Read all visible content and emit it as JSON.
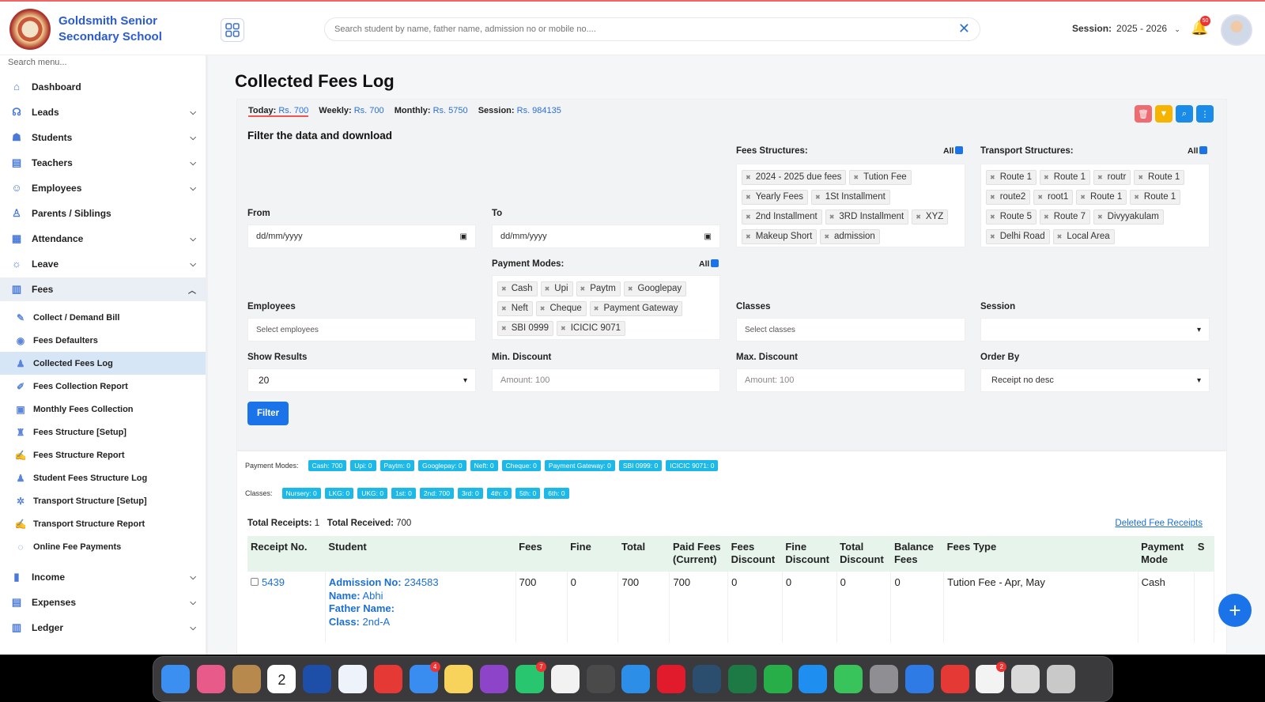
{
  "app": {
    "school_name_line1": "Goldsmith Senior",
    "school_name_line2": "Secondary School",
    "search_placeholder": "Search student by name, father name, admission no or mobile no....",
    "session_label": "Session:",
    "session_value": "2025 - 2026",
    "notification_count": "50"
  },
  "sidebar": {
    "search_placeholder": "Search menu...",
    "items": [
      {
        "label": "Dashboard",
        "icon": "home-icon"
      },
      {
        "label": "Leads",
        "icon": "leads-icon"
      },
      {
        "label": "Students",
        "icon": "students-icon"
      },
      {
        "label": "Teachers",
        "icon": "teachers-icon"
      },
      {
        "label": "Employees",
        "icon": "employees-icon"
      },
      {
        "label": "Parents / Siblings",
        "icon": "parents-icon"
      },
      {
        "label": "Attendance",
        "icon": "attendance-icon"
      },
      {
        "label": "Leave",
        "icon": "leave-icon"
      },
      {
        "label": "Fees",
        "icon": "fees-icon"
      }
    ],
    "fees_sub": [
      "Collect / Demand Bill",
      "Fees Defaulters",
      "Collected Fees Log",
      "Fees Collection Report",
      "Monthly Fees Collection",
      "Fees Structure [Setup]",
      "Fees Structure Report",
      "Student Fees Structure Log",
      "Transport Structure [Setup]",
      "Transport Structure Report",
      "Online Fee Payments"
    ],
    "bottom_items": [
      "Income",
      "Expenses",
      "Ledger"
    ]
  },
  "page": {
    "title": "Collected Fees Log",
    "today_label": "Today:",
    "today_value": "Rs. 700",
    "weekly_label": "Weekly:",
    "weekly_value": "Rs. 700",
    "monthly_label": "Monthly:",
    "monthly_value": "Rs. 5750",
    "session_label": "Session:",
    "session_value": "Rs. 984135",
    "filter_heading": "Filter the data and download"
  },
  "filters": {
    "from_label": "From",
    "from_value": "dd/mm/yyyy",
    "to_label": "To",
    "to_value": "dd/mm/yyyy",
    "fees_structures_label": "Fees Structures:",
    "transport_structures_label": "Transport Structures:",
    "payment_modes_label": "Payment Modes:",
    "all_label": "All",
    "fees_structures": [
      "2024 - 2025 due fees",
      "Tution Fee",
      "Yearly Fees",
      "1St Installment",
      "2nd Installment",
      "3RD Installment",
      "XYZ",
      "Makeup Short",
      "admission"
    ],
    "transport_structures": [
      "Route 1",
      "Route 1",
      "routr",
      "Route 1",
      "route2",
      "root1",
      "Route 1",
      "Route 1",
      "Route 5",
      "Route 7",
      "Divyyakulam",
      "Delhi Road",
      "Local Area"
    ],
    "payment_modes": [
      "Cash",
      "Upi",
      "Paytm",
      "Googlepay",
      "Neft",
      "Cheque",
      "Payment Gateway",
      "SBI 0999",
      "ICICIC 9071"
    ],
    "employees_label": "Employees",
    "employees_placeholder": "Select employees",
    "classes_label": "Classes",
    "classes_placeholder": "Select classes",
    "session_label": "Session",
    "session_value": "",
    "show_results_label": "Show Results",
    "show_results_value": "20",
    "min_discount_label": "Min. Discount",
    "min_discount_placeholder": "Amount: 100",
    "max_discount_label": "Max. Discount",
    "max_discount_placeholder": "Amount: 100",
    "order_by_label": "Order By",
    "order_by_value": "Receipt no desc",
    "filter_button": "Filter"
  },
  "summary": {
    "payment_modes_label": "Payment Modes:",
    "payment_modes": [
      "Cash: 700",
      "Upi: 0",
      "Paytm: 0",
      "Googlepay: 0",
      "Neft: 0",
      "Cheque: 0",
      "Payment Gateway: 0",
      "SBI 0999: 0",
      "ICICIC 9071: 0"
    ],
    "classes_label": "Classes:",
    "classes": [
      "Nursery: 0",
      "LKG: 0",
      "UKG: 0",
      "1st: 0",
      "2nd: 700",
      "3rd: 0",
      "4th: 0",
      "5th: 0",
      "6th: 0"
    ],
    "total_receipts_label": "Total Receipts:",
    "total_receipts_value": "1",
    "total_received_label": "Total Received:",
    "total_received_value": "700",
    "deleted_link": "Deleted Fee Receipts"
  },
  "table": {
    "headers": [
      "Receipt No.",
      "Student",
      "Fees",
      "Fine",
      "Total",
      "Paid Fees (Current)",
      "Fees Discount",
      "Fine Discount",
      "Total Discount",
      "Balance Fees",
      "Fees Type",
      "Payment Mode",
      "S"
    ],
    "row": {
      "receipt_no": "5439",
      "admission_label": "Admission No:",
      "admission_value": "234583",
      "name_label": "Name:",
      "name_value": "Abhi",
      "father_label": "Father Name:",
      "father_value": "",
      "class_label": "Class:",
      "class_value": "2nd-A",
      "fees": "700",
      "fine": "0",
      "total": "700",
      "paid": "700",
      "fees_discount": "0",
      "fine_discount": "0",
      "total_discount": "0",
      "balance": "0",
      "fees_type": "Tution Fee - Apr, May",
      "payment_mode": "Cash"
    }
  },
  "dock": {
    "icons": [
      {
        "name": "finder-icon",
        "color": "#3b8ff0"
      },
      {
        "name": "launchpad-icon",
        "color": "#e85a8a"
      },
      {
        "name": "contacts-icon",
        "color": "#b8894d"
      },
      {
        "name": "calendar-icon",
        "color": "#ffffff",
        "text": "2"
      },
      {
        "name": "vedmarg-icon",
        "color": "#1e4fa8"
      },
      {
        "name": "vedmarg-admin-icon",
        "color": "#eef2fb"
      },
      {
        "name": "anydesk-icon",
        "color": "#e53935"
      },
      {
        "name": "mail-icon",
        "color": "#3a8df0",
        "badge": "4"
      },
      {
        "name": "notes-icon",
        "color": "#f7d35b"
      },
      {
        "name": "firefox-icon",
        "color": "#8e44c8"
      },
      {
        "name": "whatsapp-icon",
        "color": "#28c76f",
        "badge": "7"
      },
      {
        "name": "chrome-icon",
        "color": "#f2f2f2"
      },
      {
        "name": "sublime-icon",
        "color": "#4a4a4a"
      },
      {
        "name": "safari-icon",
        "color": "#2d8ee8"
      },
      {
        "name": "opera-icon",
        "color": "#e21b2c"
      },
      {
        "name": "tableplus-icon",
        "color": "#2b4d6e"
      },
      {
        "name": "excel-icon",
        "color": "#1d7a45"
      },
      {
        "name": "numbers-icon",
        "color": "#27ae48"
      },
      {
        "name": "appstore-icon",
        "color": "#1f8ef1"
      },
      {
        "name": "facetime-icon",
        "color": "#38c45a"
      },
      {
        "name": "system-settings-icon",
        "color": "#8e8e93"
      },
      {
        "name": "windows-app-icon",
        "color": "#2e7be5"
      },
      {
        "name": "anydesk-icon-2",
        "color": "#e53935"
      },
      {
        "name": "microsoft-office-icon",
        "color": "#f3f3f3",
        "badge": "2"
      },
      {
        "name": "downloads-icon",
        "color": "#d9d9d9"
      },
      {
        "name": "trash-icon",
        "color": "#c9c9c9"
      }
    ]
  }
}
